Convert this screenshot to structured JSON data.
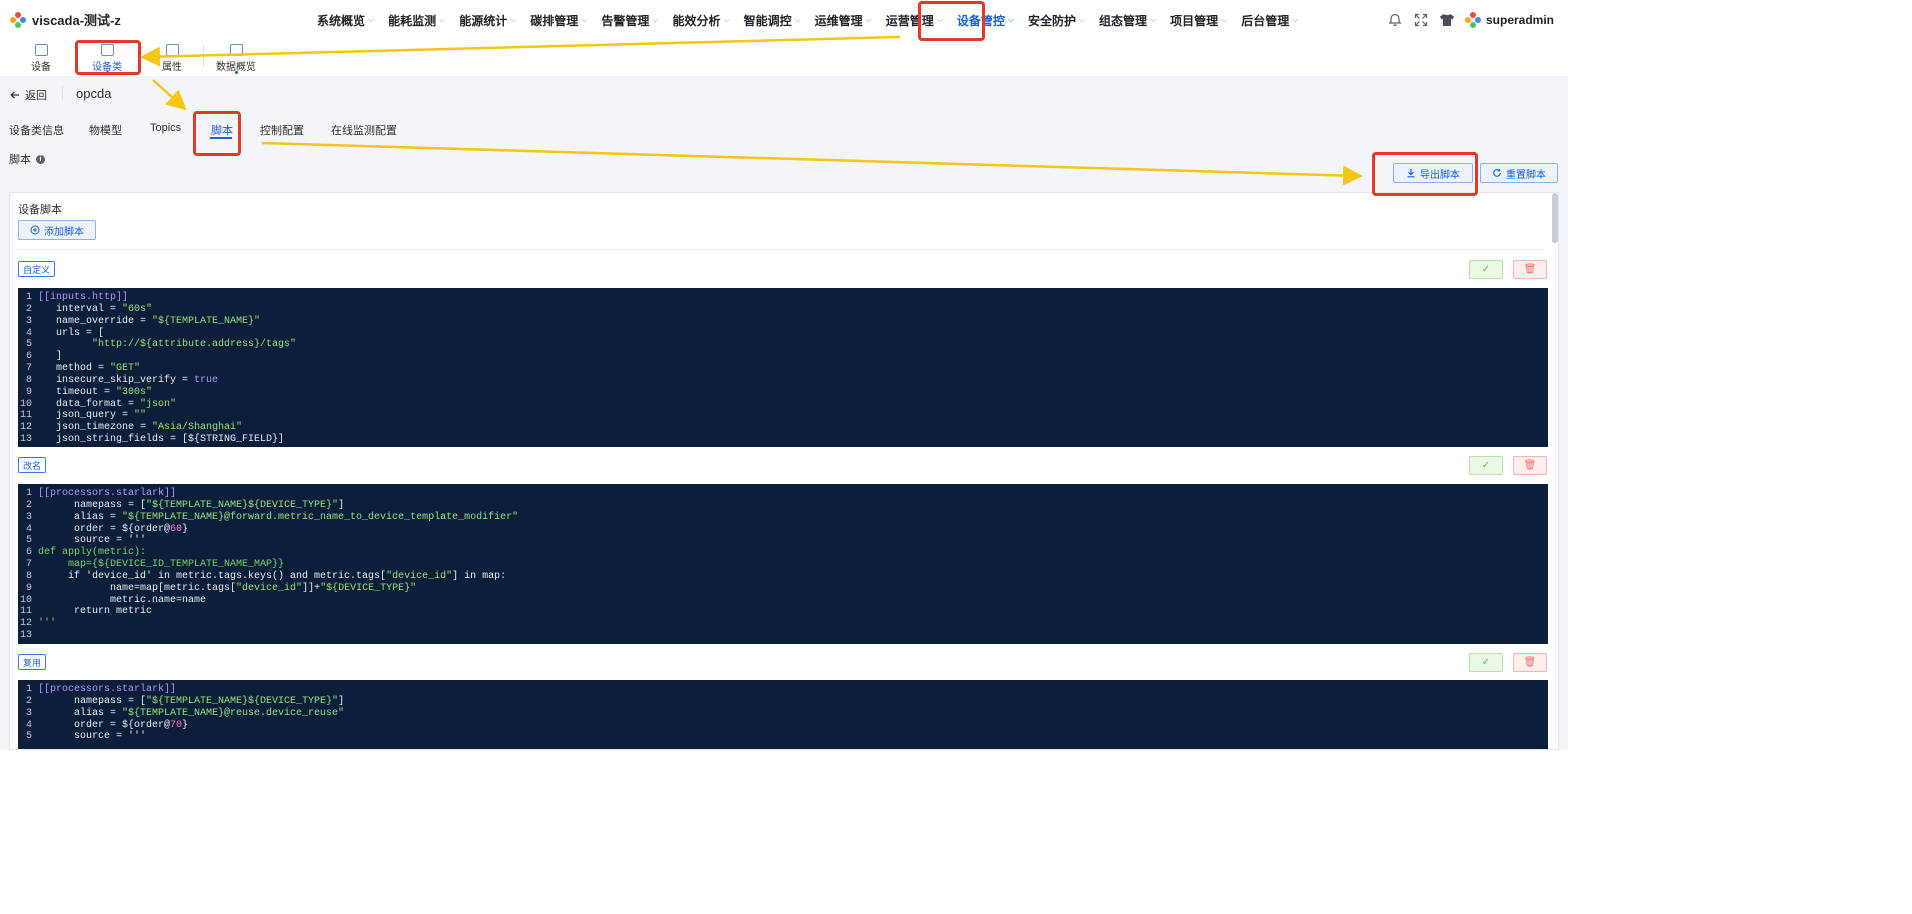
{
  "app": {
    "title": "viscada-测试-z"
  },
  "nav": {
    "items": [
      {
        "label": "系统概览"
      },
      {
        "label": "能耗监测"
      },
      {
        "label": "能源统计"
      },
      {
        "label": "碳排管理"
      },
      {
        "label": "告警管理"
      },
      {
        "label": "能效分析"
      },
      {
        "label": "智能调控"
      },
      {
        "label": "运维管理"
      },
      {
        "label": "运营管理"
      },
      {
        "label": "设备管控"
      },
      {
        "label": "安全防护"
      },
      {
        "label": "组态管理"
      },
      {
        "label": "项目管理"
      },
      {
        "label": "后台管理"
      }
    ],
    "active_index": 9
  },
  "user": {
    "name": "superadmin"
  },
  "subnav": {
    "items": [
      {
        "label": "设备"
      },
      {
        "label": "设备类"
      },
      {
        "label": "属性"
      },
      {
        "label": "数据概览"
      }
    ],
    "active_index": 1
  },
  "header": {
    "back_label": "返回",
    "page_name": "opcda"
  },
  "tabs": {
    "items": [
      {
        "label": "设备类信息"
      },
      {
        "label": "物模型"
      },
      {
        "label": "Topics"
      },
      {
        "label": "脚本"
      },
      {
        "label": "控制配置"
      },
      {
        "label": "在线监测配置"
      }
    ],
    "active_index": 3
  },
  "section": {
    "label": "脚本",
    "export_label": "导出脚本",
    "reset_label": "重置脚本"
  },
  "panel": {
    "title": "设备脚本",
    "add_label": "添加脚本"
  },
  "scripts": [
    {
      "tag": "自定义",
      "lines": [
        "[[inputs.http]]",
        "   interval = \"60s\"",
        "   name_override = \"${TEMPLATE_NAME}\"",
        "   urls = [",
        "         \"http://${attribute.address}/tags\"",
        "   ]",
        "   method = \"GET\"",
        "   insecure_skip_verify = true",
        "   timeout = \"300s\"",
        "   data_format = \"json\"",
        "   json_query = \"\"",
        "   json_timezone = \"Asia/Shanghai\"",
        "   json_string_fields = [${STRING_FIELD}]"
      ]
    },
    {
      "tag": "改名",
      "lines": [
        "[[processors.starlark]]",
        "      namepass = [\"${TEMPLATE_NAME}${DEVICE_TYPE}\"]",
        "      alias = \"${TEMPLATE_NAME}@forward.metric_name_to_device_template_modifier\"",
        "      order = ${order@60}",
        "      source = '''",
        "def apply(metric):",
        "     map={${DEVICE_ID_TEMPLATE_NAME_MAP}}",
        "     if 'device_id' in metric.tags.keys() and metric.tags[\"device_id\"] in map:",
        "            name=map[metric.tags[\"device_id\"]]+\"${DEVICE_TYPE}\"",
        "            metric.name=name",
        "      return metric",
        "'''",
        ""
      ]
    },
    {
      "tag": "复用",
      "lines": [
        "[[processors.starlark]]",
        "      namepass = [\"${TEMPLATE_NAME}${DEVICE_TYPE}\"]",
        "      alias = \"${TEMPLATE_NAME}@reuse.device_reuse\"",
        "      order = ${order@70}",
        "      source = '''"
      ]
    }
  ],
  "icons": {
    "bell": "bell-icon",
    "fullscreen": "fullscreen-icon",
    "theme": "shirt-icon",
    "check": "check-icon",
    "trash": "trash-icon"
  },
  "colors": {
    "accent": "#1d5fd6",
    "code_bg": "#0b1f3a",
    "annotation": "#e03a2b",
    "arrow": "#f5c518"
  }
}
